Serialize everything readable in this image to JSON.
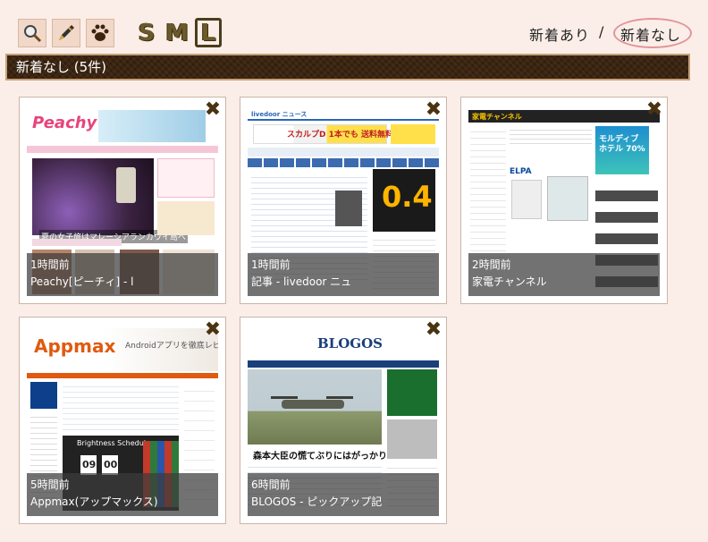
{
  "toolbar": {
    "tools": [
      {
        "name": "search-icon"
      },
      {
        "name": "pen-icon"
      },
      {
        "name": "paw-icon"
      }
    ],
    "sizes": [
      "S",
      "M",
      "L"
    ],
    "active_size": "L",
    "filters": {
      "new": "新着あり",
      "separator": "/",
      "none": "新着なし",
      "active": "none"
    }
  },
  "section": {
    "title": "新着なし (5件)"
  },
  "cards": [
    {
      "time": "1時間前",
      "title": "Peachy[ピーチィ] - l",
      "site": "peachy",
      "shot": {
        "logo": "Peachy",
        "headline": "夏の女子旅はマレーシアランカウイ島へ",
        "brand_color": "#e8447a"
      }
    },
    {
      "time": "1時間前",
      "title": "記事 - livedoor ニュ",
      "site": "livedoor",
      "shot": {
        "logo": "livedoor ニュース",
        "headline": "スカルプD 1本でも 送料無料",
        "promo": "0.4",
        "brand_color": "#2a66b8"
      }
    },
    {
      "time": "2時間前",
      "title": "家電チャンネル",
      "site": "kaden",
      "shot": {
        "logo": "家電チャンネル",
        "badge": "モルディブ ホテル 70%",
        "brand": "ELPA",
        "brand_color": "#222222"
      }
    },
    {
      "time": "5時間前",
      "title": "Appmax(アップマックス)",
      "site": "appmax",
      "shot": {
        "logo": "Appmax",
        "headline": "Androidアプリを徹底レビュー!",
        "app": "Brightness Scheduler",
        "time1": "09",
        "time2": "00",
        "brand_color": "#e05a10"
      }
    },
    {
      "time": "6時間前",
      "title": "BLOGOS - ピックアップ記",
      "site": "blogos",
      "shot": {
        "logo": "BLOGOS",
        "headline": "森本大臣の慌てぶりにはがっかり",
        "brand_color": "#1b3f7a"
      }
    }
  ]
}
